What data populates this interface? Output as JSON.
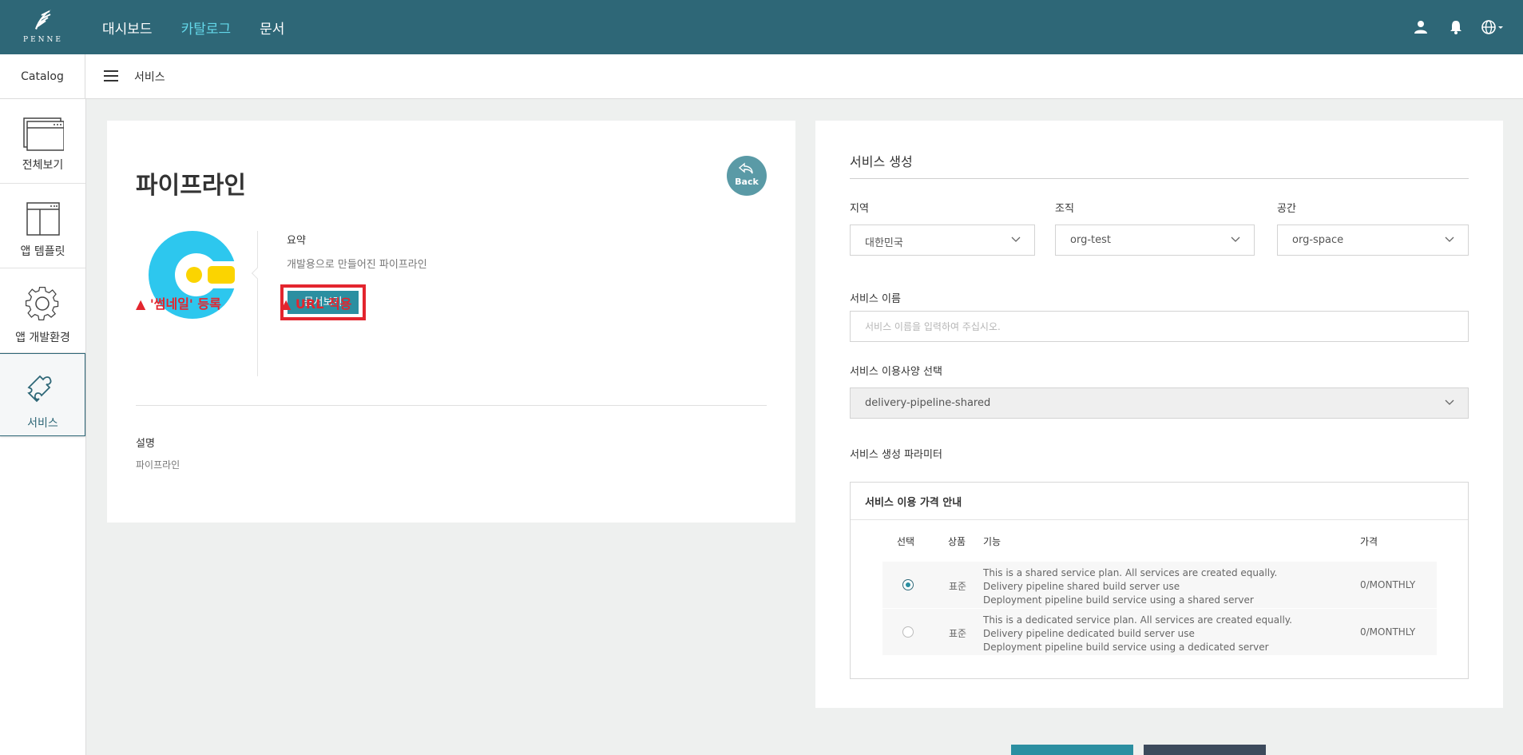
{
  "topbar": {
    "logo_text": "PENNE",
    "nav": [
      "대시보드",
      "카탈로그",
      "문서"
    ],
    "active_nav_index": 1,
    "icons": [
      "user-icon",
      "bell-icon",
      "globe-icon"
    ]
  },
  "subheader": {
    "section": "Catalog",
    "breadcrumb": "서비스"
  },
  "sidebar": {
    "items": [
      {
        "label": "전체보기",
        "icon": "window-icon"
      },
      {
        "label": "앱 템플릿",
        "icon": "template-icon"
      },
      {
        "label": "앱 개발환경",
        "icon": "gear-icon"
      },
      {
        "label": "서비스",
        "icon": "puzzle-icon",
        "active": true
      }
    ]
  },
  "detail": {
    "title": "파이프라인",
    "back_label": "Back",
    "summary_label": "요약",
    "summary_text": "개발용으로 만들어진 파이프라인",
    "doc_button": "문서보기",
    "annotation_thumbnail": "▲ '썸네일' 등록",
    "annotation_url": "▲ URL 적용",
    "description_label": "설명",
    "description_text": "파이프라인"
  },
  "form": {
    "title": "서비스 생성",
    "region_label": "지역",
    "region_value": "대한민국",
    "org_label": "조직",
    "org_value": "org-test",
    "space_label": "공간",
    "space_value": "org-space",
    "name_label": "서비스 이름",
    "name_placeholder": "서비스 이름을 입력하여 주십시오.",
    "plan_label": "서비스 이용사양 선택",
    "plan_value": "delivery-pipeline-shared",
    "params_label": "서비스 생성 파라미터",
    "price_title": "서비스 이용 가격 안내",
    "columns": [
      "선택",
      "상품",
      "기능",
      "가격"
    ],
    "plans": [
      {
        "selected": true,
        "product": "표준",
        "features": [
          "This is a shared service plan. All services are created equally.",
          "Delivery pipeline shared build server use",
          "Deployment pipeline build service using a shared server"
        ],
        "price": "0/MONTHLY"
      },
      {
        "selected": false,
        "product": "표준",
        "features": [
          "This is a dedicated service plan. All services are created equally.",
          "Delivery pipeline dedicated build server use",
          "Deployment pipeline build service using a dedicated server"
        ],
        "price": "0/MONTHLY"
      }
    ]
  },
  "colors": {
    "topbar": "#2e6777",
    "accent": "#2b8fa1",
    "nav_active": "#64d8ea",
    "annotation_red": "#e3252e",
    "bottom_button_primary": "#2b8fa1",
    "bottom_button_secondary": "#3c4a5c"
  }
}
